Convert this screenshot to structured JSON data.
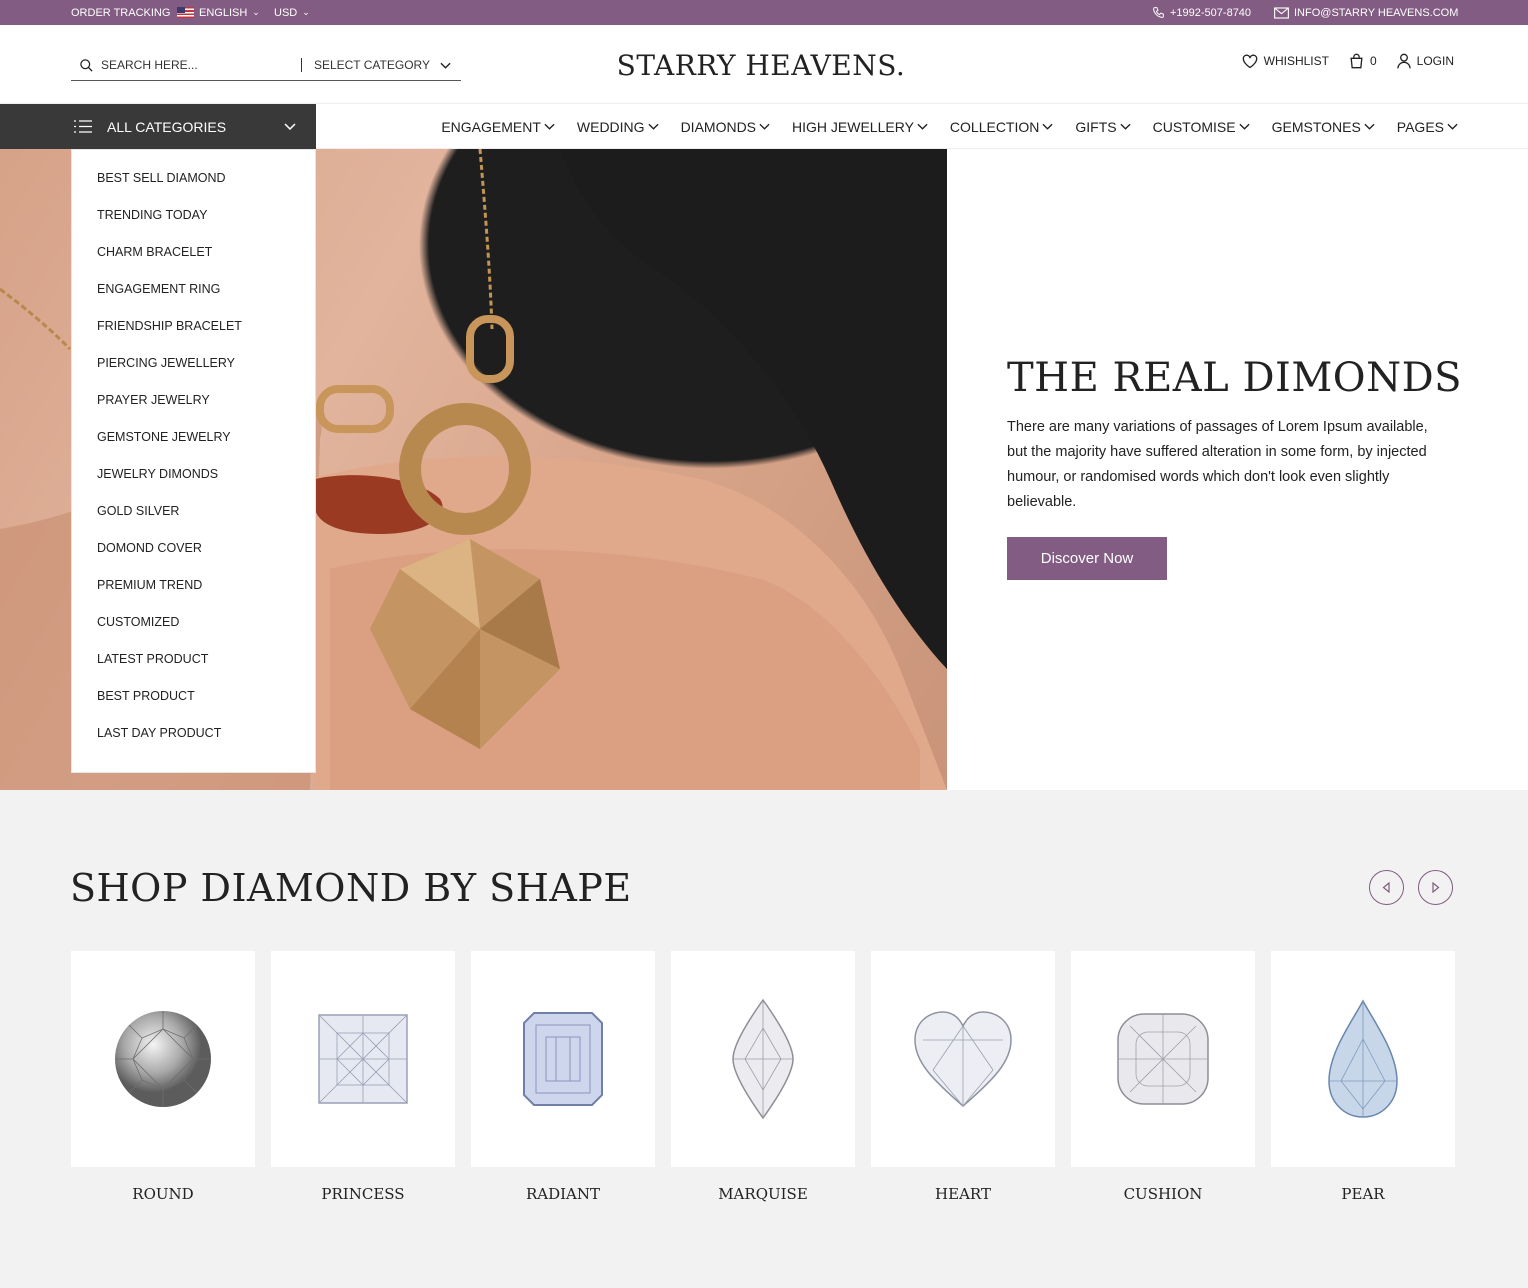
{
  "topbar": {
    "order_tracking": "ORDER TRACKING",
    "language": "ENGLISH",
    "currency": "USD",
    "phone": "+1992-507-8740",
    "email": "INFO@STARRY HEAVENS.COM"
  },
  "header": {
    "search_placeholder": "SEARCH HERE...",
    "select_category": "SELECT CATEGORY",
    "logo": "STARRY HEAVENS.",
    "wishlist": "WHISHLIST",
    "cart_count": "0",
    "login": "LOGIN"
  },
  "nav": {
    "all_categories": "ALL CATEGORIES",
    "items": [
      "ENGAGEMENT",
      "WEDDING",
      "DIAMONDS",
      "HIGH JEWELLERY",
      "COLLECTION",
      "GIFTS",
      "CUSTOMISE",
      "GEMSTONES",
      "PAGES"
    ]
  },
  "categories": [
    "BEST SELL  DIAMOND",
    "TRENDING TODAY",
    "CHARM BRACELET",
    "ENGAGEMENT RING",
    "FRIENDSHIP BRACELET",
    "PIERCING JEWELLERY",
    "PRAYER JEWELRY",
    "GEMSTONE JEWELRY",
    "JEWELRY DIMONDS",
    "GOLD SILVER",
    "DOMOND COVER",
    "PREMIUM TREND",
    "CUSTOMIZED",
    "LATEST PRODUCT",
    "BEST PRODUCT",
    "LAST DAY PRODUCT"
  ],
  "hero": {
    "title": "THE REAL DIMONDS",
    "description": "There are many variations of passages of Lorem Ipsum available, but the majority have suffered alteration in some form, by injected humour, or randomised words which don't look even slightly believable.",
    "button": "Discover Now"
  },
  "shapes": {
    "title": "SHOP DIAMOND BY SHAPE",
    "items": [
      "ROUND",
      "PRINCESS",
      "RADIANT",
      "MARQUISE",
      "HEART",
      "CUSHION",
      "PEAR"
    ]
  },
  "colors": {
    "brand": "#825c82",
    "dark": "#393939",
    "section_bg": "#f2f2f2"
  }
}
